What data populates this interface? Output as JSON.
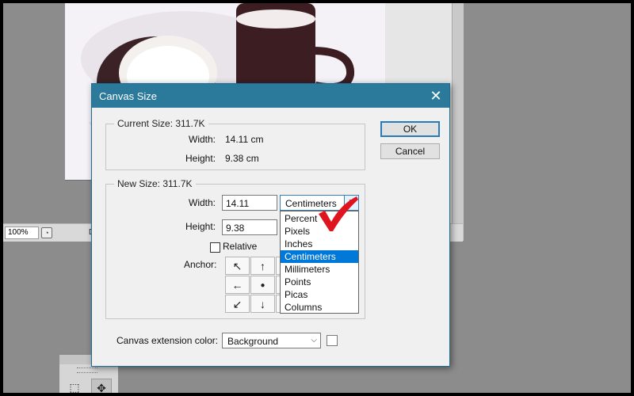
{
  "status_bar": {
    "zoom": "100%",
    "doc_label": "D"
  },
  "dialog": {
    "title": "Canvas Size",
    "close_glyph": "✕",
    "current": {
      "legend": "Current Size: 311.7K",
      "width_label": "Width:",
      "width_value": "14.11 cm",
      "height_label": "Height:",
      "height_value": "9.38 cm"
    },
    "new": {
      "legend": "New Size: 311.7K",
      "width_label": "Width:",
      "width_value": "14.11",
      "height_label": "Height:",
      "height_value": "9.38",
      "relative_label": "Relative",
      "anchor_label": "Anchor:"
    },
    "unit_select": {
      "selected": "Centimeters",
      "options": [
        "Percent",
        "Pixels",
        "Inches",
        "Centimeters",
        "Millimeters",
        "Points",
        "Picas",
        "Columns"
      ]
    },
    "buttons": {
      "ok": "OK",
      "cancel": "Cancel"
    },
    "extension": {
      "label": "Canvas extension color:",
      "value": "Background"
    }
  },
  "anchor_glyphs": [
    "↖",
    "↑",
    "↗",
    "←",
    "●",
    "→",
    "↙",
    "↓",
    "↘"
  ],
  "colors": {
    "titlebar": "#2b7a9b",
    "selection": "#0078d7",
    "checkmark": "#e0141e"
  },
  "icons": [
    "close-icon",
    "chevron-down-icon",
    "marquee-tool-icon",
    "move-tool-icon",
    "checkmark-icon"
  ]
}
